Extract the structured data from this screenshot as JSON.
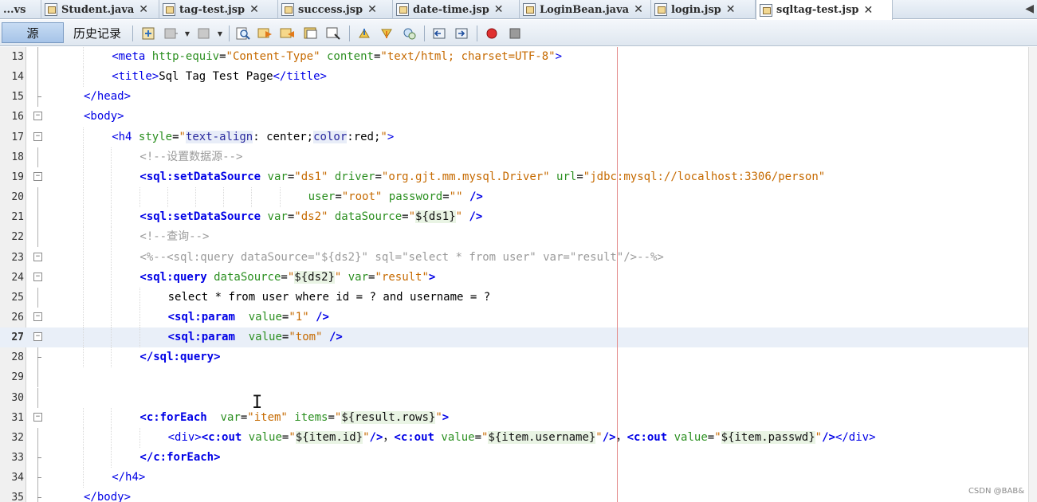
{
  "tabs": {
    "overflow_label": "...vs",
    "items": [
      {
        "label": "Student.java"
      },
      {
        "label": "tag-test.jsp"
      },
      {
        "label": "success.jsp"
      },
      {
        "label": "date-time.jsp"
      },
      {
        "label": "LoginBean.java"
      },
      {
        "label": "login.jsp"
      },
      {
        "label": "sqltag-test.jsp",
        "active": true
      }
    ],
    "close_glyph": "✕"
  },
  "toolbar": {
    "source_label": "源",
    "history_label": "历史记录",
    "icons": [
      "last-edit-icon",
      "back-icon",
      "forward-icon",
      "find-icon",
      "find-previous-icon",
      "find-next-icon",
      "toggle-highlight-icon",
      "find-selection-icon",
      "previous-bookmark-icon",
      "next-bookmark-icon",
      "toggle-bookmark-icon",
      "shift-left-icon",
      "shift-right-icon",
      "start-macro-icon",
      "stop-macro-icon"
    ]
  },
  "editor": {
    "lines": [
      {
        "n": "13",
        "indent": 2,
        "fold": "line",
        "html": "<span class='tk-tag'>&lt;meta</span> <span class='tk-attr'>http-equiv</span>=<span class='tk-val'>\"Content-Type\"</span> <span class='tk-attr'>content</span>=<span class='tk-val'>\"text/html; charset=UTF-8\"</span><span class='tk-tag'>&gt;</span>"
      },
      {
        "n": "14",
        "indent": 2,
        "fold": "line",
        "html": "<span class='tk-tag'>&lt;title&gt;</span>Sql Tag Test Page<span class='tk-tag'>&lt;/title&gt;</span>"
      },
      {
        "n": "15",
        "indent": 1,
        "fold": "end",
        "html": "<span class='tk-tag'>&lt;/head&gt;</span>"
      },
      {
        "n": "16",
        "indent": 1,
        "fold": "open",
        "html": "<span class='tk-tag'>&lt;body&gt;</span>"
      },
      {
        "n": "17",
        "indent": 2,
        "fold": "open",
        "html": "<span class='tk-tag'>&lt;h4</span> <span class='tk-attr'>style</span>=<span class='tk-val'>\"</span><span class='tk-css-hl'>text-align</span>: center;<span class='tk-css-hl'>color</span>:red;<span class='tk-val'>\"</span><span class='tk-tag'>&gt;</span>"
      },
      {
        "n": "18",
        "indent": 3,
        "fold": "line",
        "html": "<span class='tk-com'>&lt;!--设置数据源--&gt;</span>"
      },
      {
        "n": "19",
        "indent": 3,
        "fold": "open",
        "html": "<span class='tk-tagb'>&lt;sql:setDataSource</span> <span class='tk-attr'>var</span>=<span class='tk-val'>\"ds1\"</span> <span class='tk-attr'>driver</span>=<span class='tk-val'>\"org.gjt.mm.mysql.Driver\"</span> <span class='tk-attr'>url</span>=<span class='tk-val'>\"jdbc:mysql://localhost:3306/person\"</span>"
      },
      {
        "n": "20",
        "indent": 9,
        "fold": "line",
        "html": "<span class='tk-attr'>user</span>=<span class='tk-val'>\"root\"</span> <span class='tk-attr'>password</span>=<span class='tk-val'>\"\"</span> <span class='tk-tagb'>/&gt;</span>"
      },
      {
        "n": "21",
        "indent": 3,
        "fold": "line",
        "html": "<span class='tk-tagb'>&lt;sql:setDataSource</span> <span class='tk-attr'>var</span>=<span class='tk-val'>\"ds2\"</span> <span class='tk-attr'>dataSource</span>=<span class='tk-val'>\"</span><span class='tk-el'>${ds1}</span><span class='tk-val'>\"</span> <span class='tk-tagb'>/&gt;</span>"
      },
      {
        "n": "22",
        "indent": 3,
        "fold": "line",
        "html": "<span class='tk-com'>&lt;!--查询--&gt;</span>"
      },
      {
        "n": "23",
        "indent": 3,
        "fold": "open",
        "html": "<span class='tk-com'>&lt;%--&lt;sql:query dataSource=\"${ds2}\" sql=\"select * from user\" var=\"result\"/&gt;--%&gt;</span>"
      },
      {
        "n": "24",
        "indent": 3,
        "fold": "open",
        "html": "<span class='tk-tagb'>&lt;sql:query</span> <span class='tk-attr'>dataSource</span>=<span class='tk-val'>\"</span><span class='tk-el'>${ds2}</span><span class='tk-val'>\"</span> <span class='tk-attr'>var</span>=<span class='tk-val'>\"result\"</span><span class='tk-tagb'>&gt;</span>"
      },
      {
        "n": "25",
        "indent": 4,
        "fold": "line",
        "html": "<span class='tk-text'>select * from user where id = ? and username = ?</span>"
      },
      {
        "n": "26",
        "indent": 4,
        "fold": "open",
        "html": "<span class='tk-tagb'>&lt;sql:param</span>  <span class='tk-attr'>value</span>=<span class='tk-val'>\"1\"</span> <span class='tk-tagb'>/&gt;</span>"
      },
      {
        "n": "27",
        "indent": 4,
        "fold": "open",
        "current": true,
        "html": "<span class='tk-tagb'>&lt;sql:param</span>  <span class='tk-attr'>value</span>=<span class='tk-val'>\"tom\"</span> <span class='tk-tagb'>/&gt;</span>"
      },
      {
        "n": "28",
        "indent": 3,
        "fold": "end",
        "html": "<span class='tk-tagb'>&lt;/sql:query&gt;</span>"
      },
      {
        "n": "29",
        "indent": 0,
        "fold": "line",
        "html": ""
      },
      {
        "n": "30",
        "indent": 0,
        "fold": "line",
        "html": ""
      },
      {
        "n": "31",
        "indent": 3,
        "fold": "open",
        "html": "<span class='tk-tagb'>&lt;c:forEach</span>  <span class='tk-attr'>var</span>=<span class='tk-val'>\"item\"</span> <span class='tk-attr'>items</span>=<span class='tk-val'>\"</span><span class='tk-el'>${result.rows}</span><span class='tk-val'>\"</span><span class='tk-tagb'>&gt;</span>"
      },
      {
        "n": "32",
        "indent": 4,
        "fold": "line",
        "html": "<span class='tk-tag'>&lt;div&gt;</span><span class='tk-tagb'>&lt;c:out</span> <span class='tk-attr'>value</span>=<span class='tk-val'>\"</span><span class='tk-el'>${item.id}</span><span class='tk-val'>\"</span><span class='tk-tagb'>/&gt;</span>，<span class='tk-tagb'>&lt;c:out</span> <span class='tk-attr'>value</span>=<span class='tk-val'>\"</span><span class='tk-el'>${item.username}</span><span class='tk-val'>\"</span><span class='tk-tagb'>/&gt;</span>，<span class='tk-tagb'>&lt;c:out</span> <span class='tk-attr'>value</span>=<span class='tk-val'>\"</span><span class='tk-el'>${item.passwd}</span><span class='tk-val'>\"</span><span class='tk-tagb'>/&gt;</span><span class='tk-tag'>&lt;/div&gt;</span>"
      },
      {
        "n": "33",
        "indent": 3,
        "fold": "end",
        "html": "<span class='tk-tagb'>&lt;/c:forEach&gt;</span>"
      },
      {
        "n": "34",
        "indent": 2,
        "fold": "end",
        "html": "<span class='tk-tag'>&lt;/h4&gt;</span>"
      },
      {
        "n": "35",
        "indent": 1,
        "fold": "end",
        "html": "<span class='tk-tag'>&lt;/body&gt;</span>"
      }
    ]
  },
  "watermark": "CSDN @BAB&"
}
